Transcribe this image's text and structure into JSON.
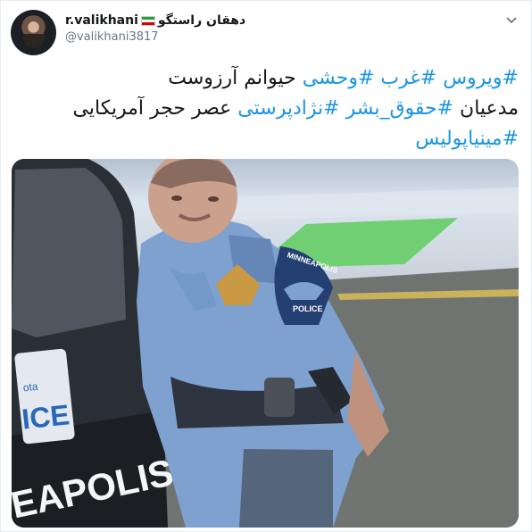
{
  "tweet": {
    "display_name": "r.valikhani",
    "display_name_fa": "دهقان راستگو",
    "handle": "@valikhani3817",
    "lines": [
      [
        {
          "text": "#ویروس",
          "tag": true
        },
        {
          "text": " ",
          "tag": false
        },
        {
          "text": "#غرب",
          "tag": true
        },
        {
          "text": " ",
          "tag": false
        },
        {
          "text": "#وحشی",
          "tag": true
        },
        {
          "text": " حیوانم آرزوست",
          "tag": false
        }
      ],
      [
        {
          "text": "مدعیان ",
          "tag": false
        },
        {
          "text": "#حقوق_بشر",
          "tag": true
        },
        {
          "text": " ",
          "tag": false
        },
        {
          "text": "#نژادپرستی",
          "tag": true
        },
        {
          "text": " عصر حجر آمریکایی",
          "tag": false
        }
      ],
      [
        {
          "text": "#مینیاپولیس",
          "tag": true
        }
      ]
    ]
  },
  "media": {
    "plate_text": "ICE",
    "plate_state": "ota",
    "car_text": "EAPOLIS",
    "patch_top": "MINNEAPOLIS",
    "patch_bottom": "POLICE"
  },
  "colors": {
    "hashtag": "#1b95e0",
    "text": "#14171a",
    "muted": "#657786"
  },
  "icons": {
    "more": "chevron-down-icon",
    "flag": "iran-flag-icon"
  }
}
